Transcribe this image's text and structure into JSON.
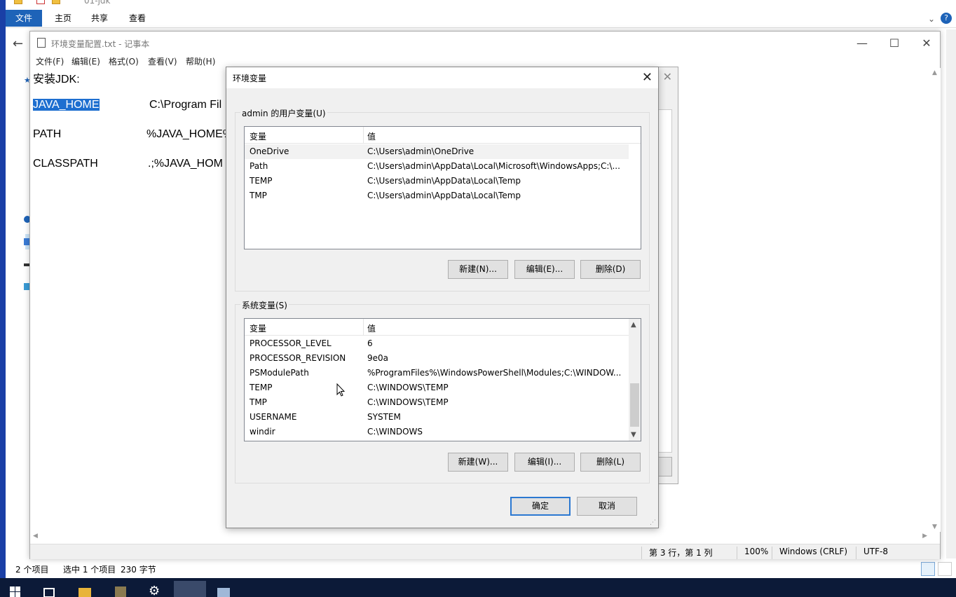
{
  "explorer": {
    "title": "01-jdk",
    "ribbon_tabs": [
      "文件",
      "主页",
      "共享",
      "查看"
    ],
    "status_items": "2 个项目",
    "status_selected": "选中 1 个项目",
    "status_size": "230 字节"
  },
  "notepad": {
    "title": "环境变量配置.txt - 记事本",
    "menu": [
      "文件(F)",
      "编辑(E)",
      "格式(O)",
      "查看(V)",
      "帮助(H)"
    ],
    "lines": [
      {
        "key": "安装JDK:",
        "value": ""
      },
      {
        "key": "JAVA_HOME",
        "value": "C:\\Program Fil"
      },
      {
        "key": "PATH",
        "value": "%JAVA_HOME%"
      },
      {
        "key": "CLASSPATH",
        "value": ".;%JAVA_HOM"
      }
    ],
    "status": {
      "position": "第 3 行，第 1 列",
      "zoom": "100%",
      "eol": "Windows (CRLF)",
      "encoding": "UTF-8"
    }
  },
  "env_dialog": {
    "title": "环境变量",
    "user_group_label": "admin 的用户变量(U)",
    "system_group_label": "系统变量(S)",
    "col_name": "变量",
    "col_value": "值",
    "user_vars": [
      {
        "name": "OneDrive",
        "value": "C:\\Users\\admin\\OneDrive"
      },
      {
        "name": "Path",
        "value": "C:\\Users\\admin\\AppData\\Local\\Microsoft\\WindowsApps;C:\\..."
      },
      {
        "name": "TEMP",
        "value": "C:\\Users\\admin\\AppData\\Local\\Temp"
      },
      {
        "name": "TMP",
        "value": "C:\\Users\\admin\\AppData\\Local\\Temp"
      }
    ],
    "system_vars": [
      {
        "name": "PROCESSOR_LEVEL",
        "value": "6"
      },
      {
        "name": "PROCESSOR_REVISION",
        "value": "9e0a"
      },
      {
        "name": "PSModulePath",
        "value": "%ProgramFiles%\\WindowsPowerShell\\Modules;C:\\WINDOW..."
      },
      {
        "name": "TEMP",
        "value": "C:\\WINDOWS\\TEMP"
      },
      {
        "name": "TMP",
        "value": "C:\\WINDOWS\\TEMP"
      },
      {
        "name": "USERNAME",
        "value": "SYSTEM"
      },
      {
        "name": "windir",
        "value": "C:\\WINDOWS"
      }
    ],
    "user_buttons": {
      "new": "新建(N)...",
      "edit": "编辑(E)...",
      "delete": "删除(D)"
    },
    "system_buttons": {
      "new": "新建(W)...",
      "edit": "编辑(I)...",
      "delete": "删除(L)"
    },
    "ok": "确定",
    "cancel": "取消"
  },
  "colors": {
    "accent": "#1e63b8",
    "selection": "#1e6fd0",
    "taskbar": "#0c1a38"
  }
}
